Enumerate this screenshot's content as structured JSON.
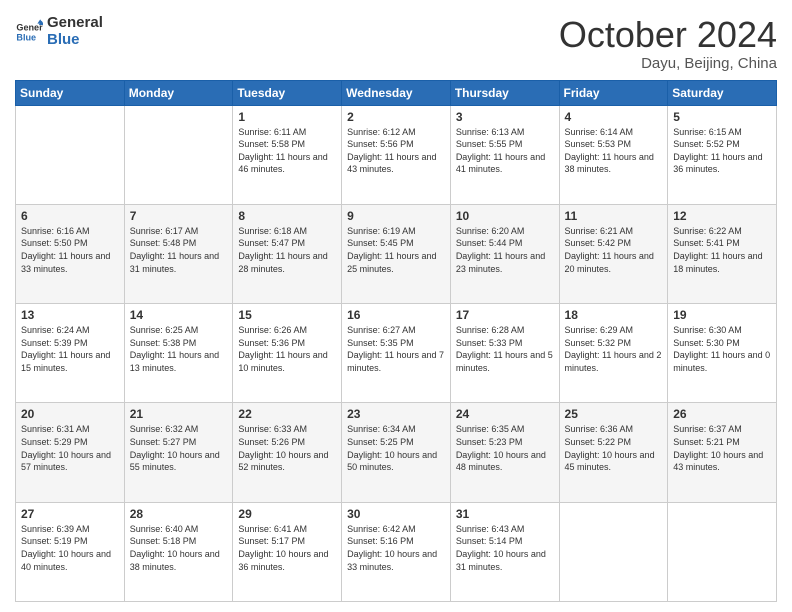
{
  "logo": {
    "line1": "General",
    "line2": "Blue"
  },
  "title": "October 2024",
  "location": "Dayu, Beijing, China",
  "weekdays": [
    "Sunday",
    "Monday",
    "Tuesday",
    "Wednesday",
    "Thursday",
    "Friday",
    "Saturday"
  ],
  "weeks": [
    [
      null,
      null,
      {
        "day": 1,
        "sunrise": "6:11 AM",
        "sunset": "5:58 PM",
        "daylight": "11 hours and 46 minutes."
      },
      {
        "day": 2,
        "sunrise": "6:12 AM",
        "sunset": "5:56 PM",
        "daylight": "11 hours and 43 minutes."
      },
      {
        "day": 3,
        "sunrise": "6:13 AM",
        "sunset": "5:55 PM",
        "daylight": "11 hours and 41 minutes."
      },
      {
        "day": 4,
        "sunrise": "6:14 AM",
        "sunset": "5:53 PM",
        "daylight": "11 hours and 38 minutes."
      },
      {
        "day": 5,
        "sunrise": "6:15 AM",
        "sunset": "5:52 PM",
        "daylight": "11 hours and 36 minutes."
      }
    ],
    [
      {
        "day": 6,
        "sunrise": "6:16 AM",
        "sunset": "5:50 PM",
        "daylight": "11 hours and 33 minutes."
      },
      {
        "day": 7,
        "sunrise": "6:17 AM",
        "sunset": "5:48 PM",
        "daylight": "11 hours and 31 minutes."
      },
      {
        "day": 8,
        "sunrise": "6:18 AM",
        "sunset": "5:47 PM",
        "daylight": "11 hours and 28 minutes."
      },
      {
        "day": 9,
        "sunrise": "6:19 AM",
        "sunset": "5:45 PM",
        "daylight": "11 hours and 25 minutes."
      },
      {
        "day": 10,
        "sunrise": "6:20 AM",
        "sunset": "5:44 PM",
        "daylight": "11 hours and 23 minutes."
      },
      {
        "day": 11,
        "sunrise": "6:21 AM",
        "sunset": "5:42 PM",
        "daylight": "11 hours and 20 minutes."
      },
      {
        "day": 12,
        "sunrise": "6:22 AM",
        "sunset": "5:41 PM",
        "daylight": "11 hours and 18 minutes."
      }
    ],
    [
      {
        "day": 13,
        "sunrise": "6:24 AM",
        "sunset": "5:39 PM",
        "daylight": "11 hours and 15 minutes."
      },
      {
        "day": 14,
        "sunrise": "6:25 AM",
        "sunset": "5:38 PM",
        "daylight": "11 hours and 13 minutes."
      },
      {
        "day": 15,
        "sunrise": "6:26 AM",
        "sunset": "5:36 PM",
        "daylight": "11 hours and 10 minutes."
      },
      {
        "day": 16,
        "sunrise": "6:27 AM",
        "sunset": "5:35 PM",
        "daylight": "11 hours and 7 minutes."
      },
      {
        "day": 17,
        "sunrise": "6:28 AM",
        "sunset": "5:33 PM",
        "daylight": "11 hours and 5 minutes."
      },
      {
        "day": 18,
        "sunrise": "6:29 AM",
        "sunset": "5:32 PM",
        "daylight": "11 hours and 2 minutes."
      },
      {
        "day": 19,
        "sunrise": "6:30 AM",
        "sunset": "5:30 PM",
        "daylight": "11 hours and 0 minutes."
      }
    ],
    [
      {
        "day": 20,
        "sunrise": "6:31 AM",
        "sunset": "5:29 PM",
        "daylight": "10 hours and 57 minutes."
      },
      {
        "day": 21,
        "sunrise": "6:32 AM",
        "sunset": "5:27 PM",
        "daylight": "10 hours and 55 minutes."
      },
      {
        "day": 22,
        "sunrise": "6:33 AM",
        "sunset": "5:26 PM",
        "daylight": "10 hours and 52 minutes."
      },
      {
        "day": 23,
        "sunrise": "6:34 AM",
        "sunset": "5:25 PM",
        "daylight": "10 hours and 50 minutes."
      },
      {
        "day": 24,
        "sunrise": "6:35 AM",
        "sunset": "5:23 PM",
        "daylight": "10 hours and 48 minutes."
      },
      {
        "day": 25,
        "sunrise": "6:36 AM",
        "sunset": "5:22 PM",
        "daylight": "10 hours and 45 minutes."
      },
      {
        "day": 26,
        "sunrise": "6:37 AM",
        "sunset": "5:21 PM",
        "daylight": "10 hours and 43 minutes."
      }
    ],
    [
      {
        "day": 27,
        "sunrise": "6:39 AM",
        "sunset": "5:19 PM",
        "daylight": "10 hours and 40 minutes."
      },
      {
        "day": 28,
        "sunrise": "6:40 AM",
        "sunset": "5:18 PM",
        "daylight": "10 hours and 38 minutes."
      },
      {
        "day": 29,
        "sunrise": "6:41 AM",
        "sunset": "5:17 PM",
        "daylight": "10 hours and 36 minutes."
      },
      {
        "day": 30,
        "sunrise": "6:42 AM",
        "sunset": "5:16 PM",
        "daylight": "10 hours and 33 minutes."
      },
      {
        "day": 31,
        "sunrise": "6:43 AM",
        "sunset": "5:14 PM",
        "daylight": "10 hours and 31 minutes."
      },
      null,
      null
    ]
  ],
  "labels": {
    "sunrise_prefix": "Sunrise: ",
    "sunset_prefix": "Sunset: ",
    "daylight_prefix": "Daylight: "
  }
}
